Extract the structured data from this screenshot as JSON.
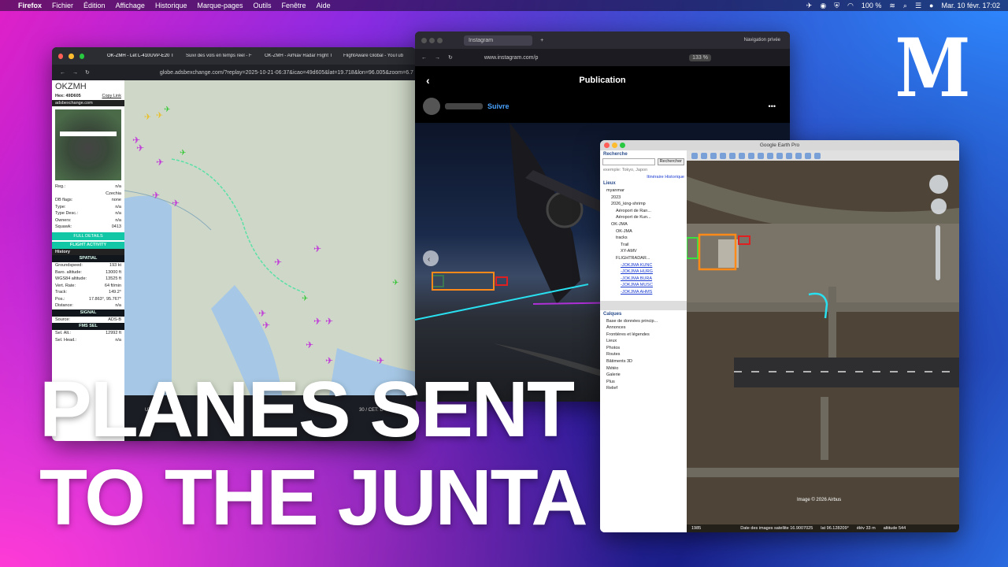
{
  "menubar": {
    "apple": "",
    "app": "Firefox",
    "items": [
      "Fichier",
      "Édition",
      "Affichage",
      "Historique",
      "Marque-pages",
      "Outils",
      "Fenêtre",
      "Aide"
    ],
    "battery": "100 %",
    "datetime": "Mar. 10 févr.  17:02"
  },
  "logo": "M",
  "adsb": {
    "tabs": [
      "OK-ZMH - Let L-410UVP-E20 T",
      "Suivi des vols en temps réel - F",
      "OK-ZMH - AirNav Radar Flight T",
      "FlightAware Global - YouTub"
    ],
    "url": "globe.adsbexchange.com/?replay=2025-10-21-06:37&icao=49d605&lat=19.718&lon=96.005&zoom=6.7",
    "callsign": "OKZMH",
    "hex_label": "Hex:",
    "hex": "49D605",
    "copy_link": "Copy Link",
    "site": "adsbexchange.com",
    "rows1": [
      [
        "Reg.:",
        "n/a"
      ],
      [
        "",
        "Czechia"
      ],
      [
        "DB flags:",
        "none"
      ],
      [
        "Type:",
        "n/a"
      ],
      [
        "Type Desc.:",
        "n/a"
      ],
      [
        "Owners:",
        "n/a"
      ],
      [
        "Squawk:",
        "0413"
      ]
    ],
    "full_details": "FULL DETAILS",
    "flight_activity": "FLIGHT ACTIVITY",
    "history": "History",
    "spatial": "SPATIAL",
    "rows2": [
      [
        "Groundspeed:",
        "193 kt"
      ],
      [
        "Baro. altitude:",
        "13000 ft"
      ],
      [
        "WGS84 altitude:",
        "13525 ft"
      ],
      [
        "Vert. Rate:",
        "64 ft/min"
      ],
      [
        "Track:",
        "149.2°"
      ],
      [
        "Pos.:",
        "17.863°, 95.767°"
      ],
      [
        "Distance:",
        "n/a"
      ]
    ],
    "signal": "SIGNAL",
    "source_label": "Source:",
    "source": "ADS-B",
    "fms": "FMS SEL",
    "rows3": [
      [
        "Sel. Alt.:",
        "12992 ft"
      ],
      [
        "Sel. Head.:",
        "n/a"
      ]
    ],
    "utc": "UTC D",
    "cet": "30 / CET: D"
  },
  "instagram": {
    "tab": "Instagram",
    "private": "Navigation privée",
    "url": "www.instagram.com/p",
    "zoom": "133 %",
    "title": "Publication",
    "follow": "Suivre",
    "more": "•••"
  },
  "earth": {
    "title": "Google Earth Pro",
    "search_head": "Recherche",
    "search_btn": "Rechercher",
    "example": "exemple: Tokyo, Japon",
    "itin": "Itinéraire",
    "hist": "Historique",
    "places_head": "Lieux",
    "tree": [
      "myanmar",
      "2023",
      "2026_king-shrimp",
      "Aéroport de Ran...",
      "Aéroport de Kun...",
      "OK-JMA",
      "OK-JMA",
      "tracks",
      "Trail",
      "XY-AMV",
      "FLIGHTRADAR...",
      "-JOKJMA KUNC",
      "-JOKJMA HURG",
      "-JOKJMA BURA",
      "-JOKJMA MUSC",
      "-JOKJMA AHMS"
    ],
    "layers_head": "Calques",
    "layers": [
      "Base de données princip...",
      "Annonces",
      "Frontières et légendes",
      "Lieux",
      "Photos",
      "Routes",
      "Bâtiments 3D",
      "Météo",
      "Galerie",
      "Plus",
      "Relief"
    ],
    "image_credit": "Image © 2026 Airbus",
    "year": "1985",
    "status": [
      "Date des images satellite 16.9007025",
      "lat  96.128209°",
      "élév  33 m",
      "altitude  544"
    ]
  },
  "headline": {
    "line1": "PLANES SENT",
    "line2": "TO THE JUNTA"
  }
}
